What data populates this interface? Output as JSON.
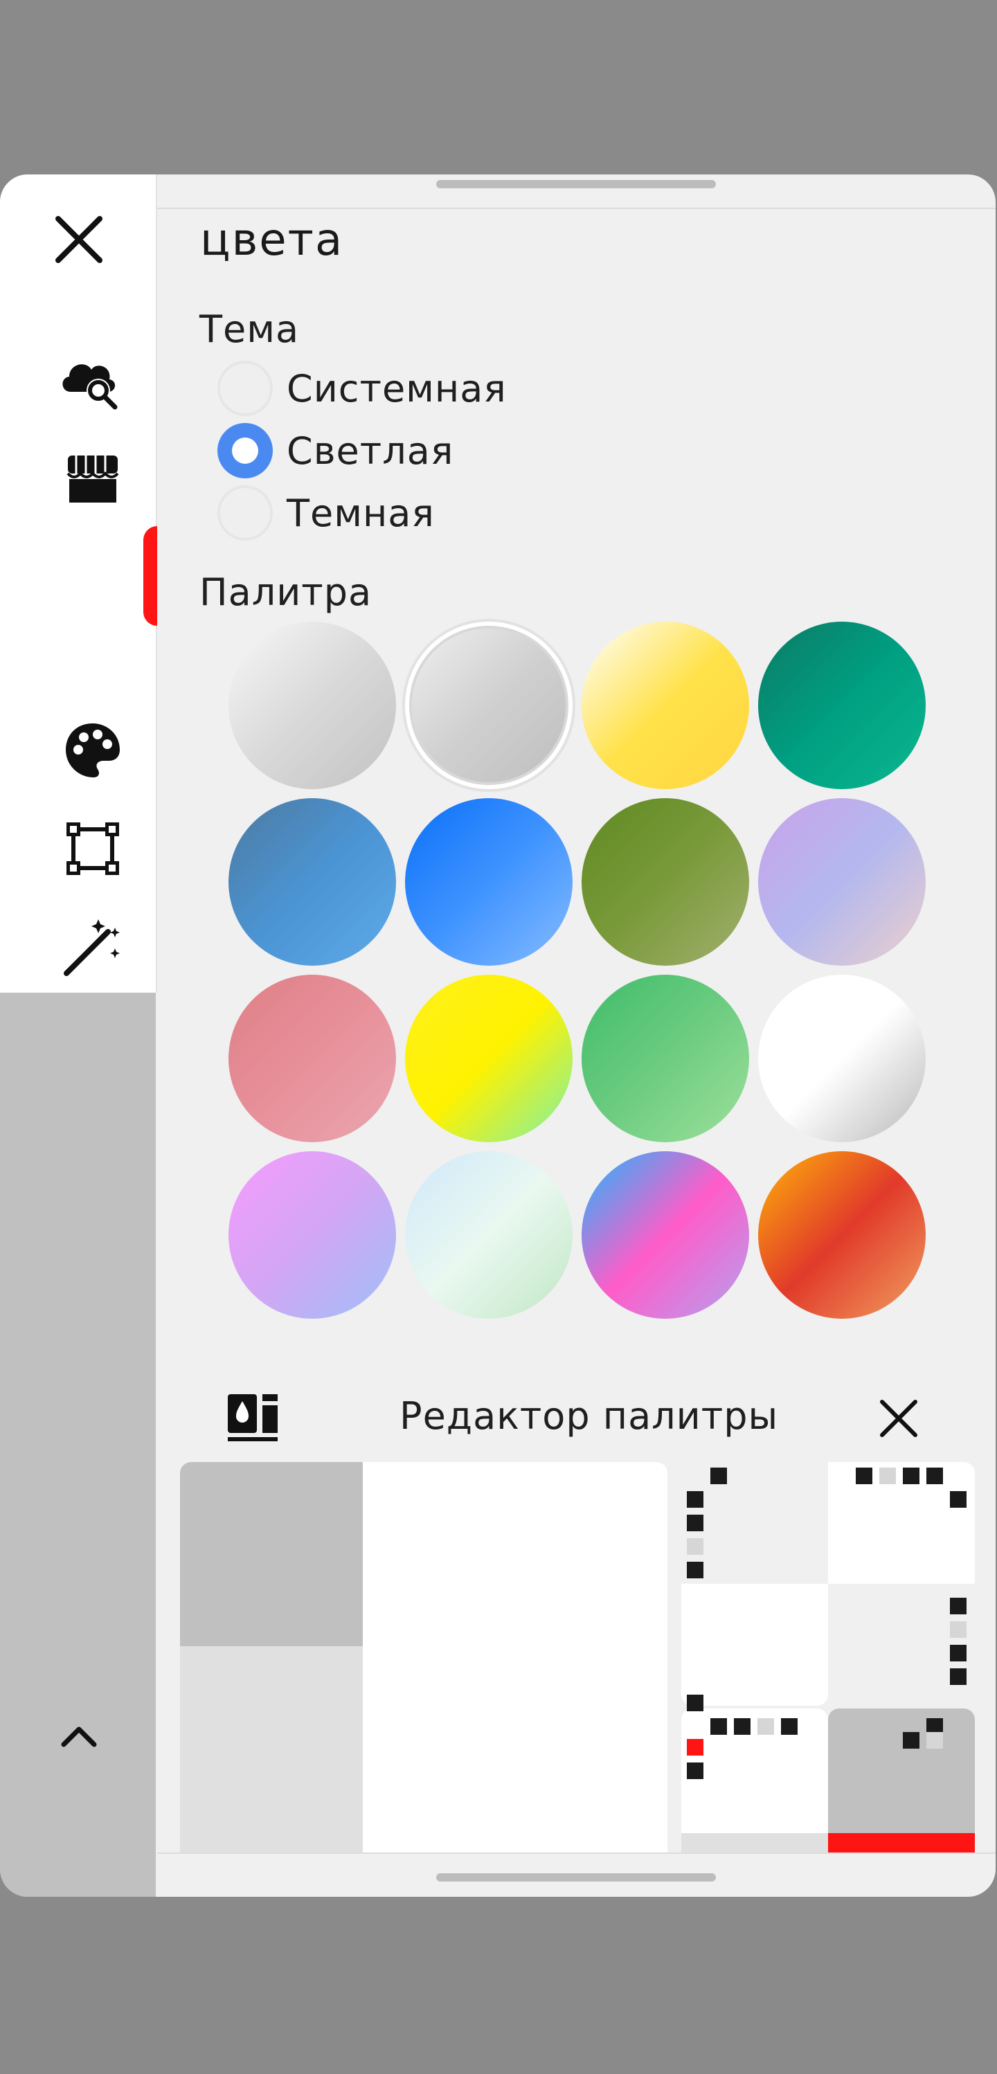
{
  "panel": {
    "title": "цвета",
    "theme": {
      "label": "Тема",
      "options": [
        {
          "label": "Системная",
          "selected": false
        },
        {
          "label": "Светлая",
          "selected": true
        },
        {
          "label": "Темная",
          "selected": false
        }
      ]
    },
    "palette": {
      "label": "Палитра",
      "swatches": [
        {
          "id": "silver",
          "colors": [
            "#f8f8f8",
            "#d9d9d9",
            "#c2c2c2"
          ]
        },
        {
          "id": "silver-ring",
          "colors": [
            "#f2f2f2",
            "#d0d0d0",
            "#bdbdbd"
          ],
          "selected": true
        },
        {
          "id": "gold",
          "colors": [
            "#ffffff",
            "#ffe24a",
            "#ffd640"
          ]
        },
        {
          "id": "teal",
          "colors": [
            "#0b7a64",
            "#009f82",
            "#0bb78f"
          ]
        },
        {
          "id": "steel-blue",
          "colors": [
            "#4d7aa0",
            "#4b94d4",
            "#5eaae8"
          ]
        },
        {
          "id": "blue",
          "colors": [
            "#0a6ff8",
            "#3f93ff",
            "#86bcff"
          ]
        },
        {
          "id": "olive",
          "colors": [
            "#5e8a22",
            "#7a9a3a",
            "#a2b070"
          ]
        },
        {
          "id": "lavender",
          "colors": [
            "#c9a2ea",
            "#b4b8ee",
            "#ecd0cc"
          ]
        },
        {
          "id": "rose",
          "colors": [
            "#df7f86",
            "#e7909a",
            "#eaa6b0"
          ]
        },
        {
          "id": "lemon",
          "colors": [
            "#fff01c",
            "#fff200",
            "#7df0a6"
          ]
        },
        {
          "id": "green",
          "colors": [
            "#3fbc6a",
            "#6ccc80",
            "#9fe09c"
          ]
        },
        {
          "id": "white",
          "colors": [
            "#ffffff",
            "#ffffff",
            "#b8b8b8"
          ]
        },
        {
          "id": "orchid",
          "colors": [
            "#f69cff",
            "#d3a6f4",
            "#9ec0f8"
          ]
        },
        {
          "id": "ice",
          "colors": [
            "#cfe8fb",
            "#eaf8f0",
            "#bfe7c4"
          ]
        },
        {
          "id": "neon",
          "colors": [
            "#1eb7ff",
            "#ff5cc8",
            "#b3a2f0"
          ]
        },
        {
          "id": "sunset",
          "colors": [
            "#ffb40a",
            "#e13a2a",
            "#f0a060"
          ]
        }
      ]
    }
  },
  "sidebar": {
    "items": [
      {
        "icon": "close-icon"
      },
      {
        "icon": "cloud-search-icon"
      },
      {
        "icon": "store-icon"
      },
      {
        "icon": "palette-icon",
        "active": true
      },
      {
        "icon": "transform-icon"
      },
      {
        "icon": "magic-wand-icon"
      },
      {
        "icon": "chevron-right-icon"
      }
    ],
    "bottom_icon": "chevron-up-icon"
  },
  "editor": {
    "title": "Редактор палитры",
    "icon": "palette-editor-icon",
    "close_icon": "close-icon"
  }
}
